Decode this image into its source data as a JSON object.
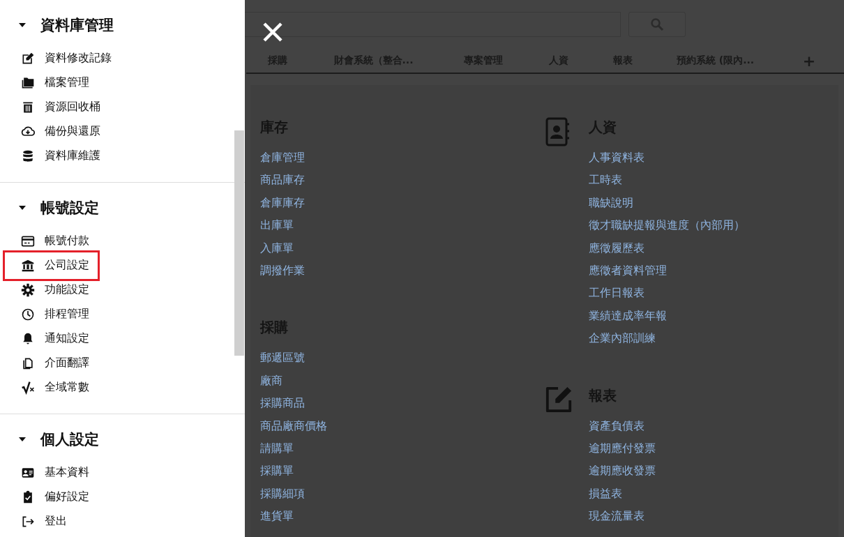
{
  "sidebar": {
    "sections": [
      {
        "title": "資料庫管理",
        "expanded": true,
        "items": [
          {
            "label": "資料修改記錄",
            "highlighted": false
          },
          {
            "label": "檔案管理",
            "highlighted": false
          },
          {
            "label": "資源回收桶",
            "highlighted": false
          },
          {
            "label": "備份與還原",
            "highlighted": false
          },
          {
            "label": "資料庫維護",
            "highlighted": false
          }
        ]
      },
      {
        "title": "帳號設定",
        "expanded": true,
        "items": [
          {
            "label": "帳號付款",
            "highlighted": false
          },
          {
            "label": "公司設定",
            "highlighted": true
          },
          {
            "label": "功能設定",
            "highlighted": false
          },
          {
            "label": "排程管理",
            "highlighted": false
          },
          {
            "label": "通知設定",
            "highlighted": false
          },
          {
            "label": "介面翻譯",
            "highlighted": false
          },
          {
            "label": "全域常數",
            "highlighted": false
          }
        ]
      },
      {
        "title": "個人設定",
        "expanded": true,
        "items": [
          {
            "label": "基本資料",
            "highlighted": false
          },
          {
            "label": "偏好設定",
            "highlighted": false
          },
          {
            "label": "登出",
            "highlighted": false
          }
        ]
      }
    ]
  },
  "tabs": [
    {
      "label": "採購"
    },
    {
      "label": "財會系統（整合..."
    },
    {
      "label": "專案管理"
    },
    {
      "label": "人資"
    },
    {
      "label": "報表"
    },
    {
      "label": "預約系統 (限內..."
    },
    {
      "label": "+"
    }
  ],
  "menu": {
    "columns": [
      [
        {
          "title": "庫存",
          "links": [
            "倉庫管理",
            "商品庫存",
            "倉庫庫存",
            "出庫單",
            "入庫單",
            "調撥作業"
          ]
        },
        {
          "title": "採購",
          "links": [
            "郵遞區號",
            "廠商",
            "採購商品",
            "商品廠商價格",
            "請購單",
            "採購單",
            "採購細項",
            "進貨單"
          ]
        }
      ],
      [
        {
          "title": "人資",
          "links": [
            "人事資料表",
            "工時表",
            "職缺說明",
            "徵才職缺提報與進度（內部用）",
            "應徵履歷表",
            "應徵者資料管理",
            "工作日報表",
            "業績達成率年報",
            "企業內部訓練"
          ]
        },
        {
          "title": "報表",
          "links": [
            "資產負債表",
            "逾期應付發票",
            "逾期應收發票",
            "損益表",
            "現金流量表"
          ]
        }
      ]
    ]
  }
}
